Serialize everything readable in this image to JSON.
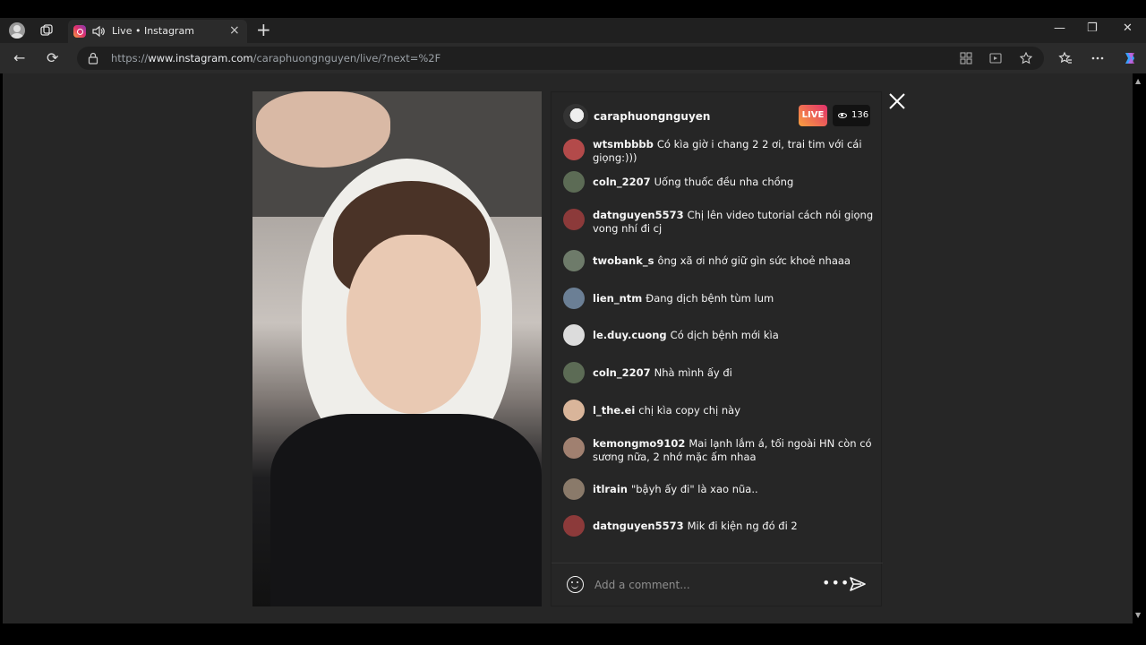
{
  "browser": {
    "tab_title": "Live • Instagram",
    "tab_close": "×",
    "new_tab": "+",
    "url_prefix": "https://",
    "url_host": "www.instagram.com",
    "url_path": "/caraphuongnguyen/live/?next=%2F",
    "minimize": "—",
    "restore": "❐",
    "close": "✕",
    "back": "←",
    "reload": "⟳"
  },
  "live": {
    "host_username": "caraphuongnguyen",
    "live_label": "LIVE",
    "viewer_count": "136",
    "comments": [
      {
        "user": "wtsmbbbb",
        "text": "Có kìa giờ i chang 2 2 ơi, trai tim với cái giọng:)))",
        "color": "#b34a4a"
      },
      {
        "user": "coln_2207",
        "text": "Uống thuốc đều nha chồng",
        "color": "#5c6b55"
      },
      {
        "user": "datnguyen5573",
        "text": "Chị lên video tutorial cách nói giọng vong nhí đi cj",
        "color": "#8c3a3a"
      },
      {
        "user": "twobank_s",
        "text": "ông xã ơi nhớ giữ gìn sức khoẻ nhaaa",
        "color": "#6e7b6a"
      },
      {
        "user": "lien_ntm",
        "text": "Đang dịch bệnh tùm lum",
        "color": "#6b7f95"
      },
      {
        "user": "le.duy.cuong",
        "text": "Có dịch bệnh mới kìa",
        "color": "#dcdcdc"
      },
      {
        "user": "coln_2207",
        "text": "Nhà mình ấy đi",
        "color": "#5c6b55"
      },
      {
        "user": "l_the.ei",
        "text": "chị kìa copy chị này",
        "color": "#d9b59a"
      },
      {
        "user": "kemongmo9102",
        "text": "Mai lạnh lắm á, tối ngoài HN còn có sương nữa, 2 nhớ mặc ấm nhaa",
        "color": "#a08070"
      },
      {
        "user": "itlrain",
        "text": "\"bậyh ấy đi\" là xao nũa..",
        "color": "#8a7a6a"
      },
      {
        "user": "datnguyen5573",
        "text": "Mik đi kiện ng đó đi 2",
        "color": "#8c3a3a"
      }
    ],
    "comment_placeholder": "Add a comment...",
    "more": "•••"
  },
  "icons": {
    "emoji": "emoji-icon",
    "send": "send-icon",
    "close": "close-icon",
    "eye": "eye-icon"
  }
}
